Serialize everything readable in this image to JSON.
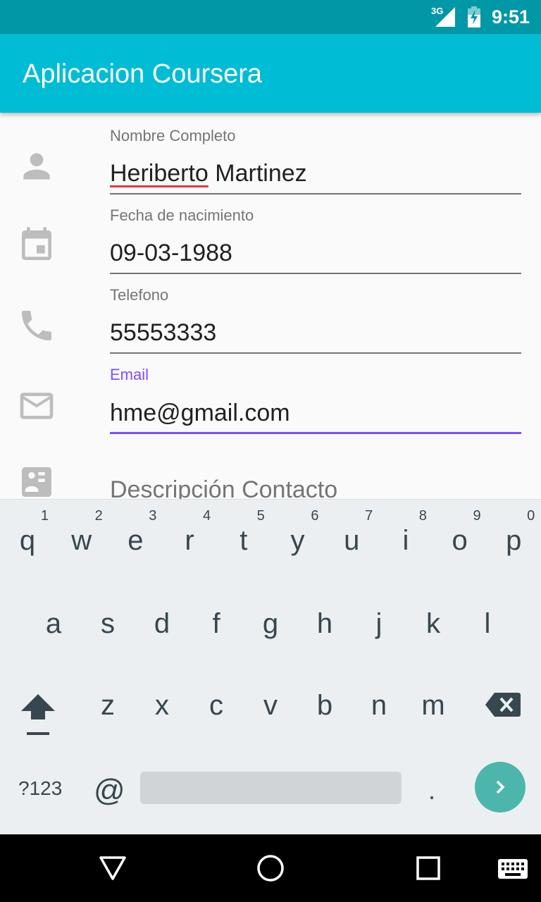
{
  "status_bar": {
    "network": "3G",
    "time": "9:51"
  },
  "app_bar": {
    "title": "Aplicacion Coursera"
  },
  "form": {
    "nombre": {
      "label": "Nombre Completo",
      "value_misspelled": "Heriberto",
      "value_rest": " Martinez",
      "icon": "person-icon"
    },
    "fecha": {
      "label": "Fecha de nacimiento",
      "value": "09-03-1988",
      "icon": "calendar-icon"
    },
    "telefono": {
      "label": "Telefono",
      "value": "55553333",
      "icon": "phone-icon"
    },
    "email": {
      "label": "Email",
      "value": "hme@gmail.com",
      "icon": "mail-icon"
    },
    "descripcion": {
      "placeholder": "Descripción Contacto",
      "icon": "contact-card-icon"
    }
  },
  "keyboard": {
    "row1": [
      {
        "letter": "q",
        "hint": "1"
      },
      {
        "letter": "w",
        "hint": "2"
      },
      {
        "letter": "e",
        "hint": "3"
      },
      {
        "letter": "r",
        "hint": "4"
      },
      {
        "letter": "t",
        "hint": "5"
      },
      {
        "letter": "y",
        "hint": "6"
      },
      {
        "letter": "u",
        "hint": "7"
      },
      {
        "letter": "i",
        "hint": "8"
      },
      {
        "letter": "o",
        "hint": "9"
      },
      {
        "letter": "p",
        "hint": "0"
      }
    ],
    "row2": [
      "a",
      "s",
      "d",
      "f",
      "g",
      "h",
      "j",
      "k",
      "l"
    ],
    "row3": [
      "z",
      "x",
      "c",
      "v",
      "b",
      "n",
      "m"
    ],
    "symbols_key": "?123",
    "at_key": "@",
    "period_key": ".",
    "accent_color": "#4db6ac"
  },
  "colors": {
    "status_bar": "#0097a7",
    "app_bar": "#00bcd4",
    "focus": "#7c4dff",
    "spell_error": "#e53935"
  }
}
